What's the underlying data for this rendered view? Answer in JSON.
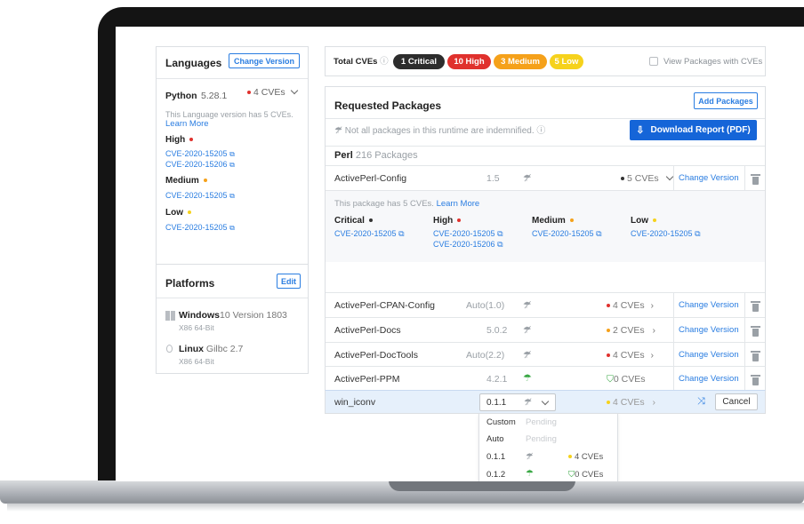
{
  "languages": {
    "title": "Languages",
    "change_version_label": "Change Version",
    "language": {
      "name": "Python",
      "version": " 5.28.1",
      "cve_count": "4 CVEs",
      "note": "This Language version has 5 CVEs.",
      "learn_more": "Learn More",
      "groups": [
        {
          "severity": "High",
          "cves": [
            "CVE-2020-15205",
            "CVE-2020-15206"
          ]
        },
        {
          "severity": "Medium",
          "cves": [
            "CVE-2020-15205"
          ]
        },
        {
          "severity": "Low",
          "cves": [
            "CVE-2020-15205"
          ]
        }
      ]
    }
  },
  "platforms": {
    "title": "Platforms",
    "edit_label": "Edit",
    "items": [
      {
        "name": "Windows",
        "version": "10 Version 1803",
        "arch": "X86 64-Bit"
      },
      {
        "name": "Linux",
        "version": "Gilbc 2.7",
        "arch": "X86 64-Bit"
      }
    ]
  },
  "totals": {
    "label": "Total CVEs",
    "badges": [
      "1 Critical",
      "10 High",
      "3 Medium",
      "5 Low"
    ],
    "view_packages_label": "View Packages with CVEs"
  },
  "packages": {
    "title": "Requested Packages",
    "add_label": "Add Packages",
    "indemnified_note": "Not all packages in this runtime are indemnified.",
    "download_label": "Download Report (PDF)",
    "group_name": "Perl",
    "group_count": "216 Packages",
    "change_version_label": "Change Version",
    "cancel_label": "Cancel",
    "rows": [
      {
        "name": "ActivePerl-Config",
        "version": "1.5",
        "cves": "5 CVEs"
      },
      {
        "name": "ActivePerl-CPAN-Config",
        "version": "Auto(1.0)",
        "cves": "4 CVEs"
      },
      {
        "name": "ActivePerl-Docs",
        "version": "5.0.2",
        "cves": "2 CVEs"
      },
      {
        "name": "ActivePerl-DocTools",
        "version": "Auto(2.2)",
        "cves": "4 CVEs"
      },
      {
        "name": "ActivePerl-PPM",
        "version": "4.2.1",
        "cves": "0 CVEs"
      },
      {
        "name": "win_iconv",
        "version": "0.1.1",
        "cves": "4 CVEs"
      }
    ],
    "detail": {
      "note": "This package has 5 CVEs.",
      "learn_more": "Learn More",
      "groups": [
        {
          "severity": "Critical",
          "cves": [
            "CVE-2020-15205"
          ]
        },
        {
          "severity": "High",
          "cves": [
            "CVE-2020-15205",
            "CVE-2020-15206"
          ]
        },
        {
          "severity": "Medium",
          "cves": [
            "CVE-2020-15205"
          ]
        },
        {
          "severity": "Low",
          "cves": [
            "CVE-2020-15205"
          ]
        }
      ]
    }
  },
  "dropdown": {
    "options": [
      {
        "label": "Custom",
        "status": "Pending"
      },
      {
        "label": "Auto",
        "status": "Pending"
      },
      {
        "label": "0.1.1",
        "cves": "4 CVEs"
      },
      {
        "label": "0.1.2",
        "cves": "0 CVEs"
      }
    ]
  },
  "icons": {
    "external": "⧉",
    "info": "ⓘ",
    "not_indemnified": "☂̸",
    "indemnified": "☂",
    "shield": "⛉",
    "download": "⇩",
    "chevron_right": "›",
    "shuffle": "⤨"
  }
}
